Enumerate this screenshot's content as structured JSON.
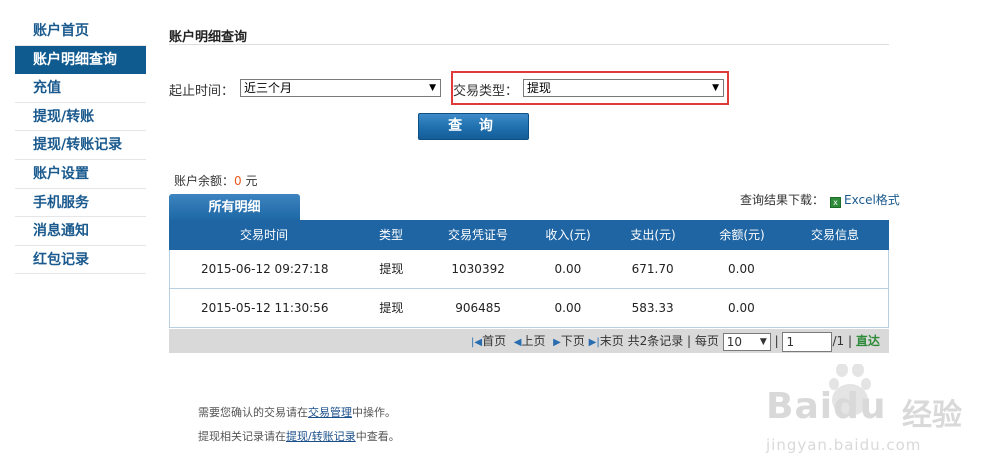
{
  "sidebar": {
    "items": [
      {
        "label": "账户首页"
      },
      {
        "label": "账户明细查询"
      },
      {
        "label": "充值"
      },
      {
        "label": "提现/转账"
      },
      {
        "label": "提现/转账记录"
      },
      {
        "label": "账户设置"
      },
      {
        "label": "手机服务"
      },
      {
        "label": "消息通知"
      },
      {
        "label": "红包记录"
      }
    ],
    "active_index": 1
  },
  "main": {
    "title": "账户明细查询",
    "filters": {
      "date_label": "起止时间：",
      "date_value": "近三个月",
      "type_label": "交易类型：",
      "type_value": "提现"
    },
    "query_button": "查 询",
    "balance_label": "账户余额：",
    "balance_value": "0",
    "balance_unit": "元",
    "download_label": "查询结果下载：",
    "download_link": "Excel格式",
    "tab_label": "所有明细",
    "table": {
      "headers": [
        "交易时间",
        "类型",
        "交易凭证号",
        "收入(元)",
        "支出(元)",
        "余额(元)",
        "交易信息"
      ],
      "rows": [
        [
          "2015-06-12 09:27:18",
          "提现",
          "1030392",
          "0.00",
          "671.70",
          "0.00",
          ""
        ],
        [
          "2015-05-12 11:30:56",
          "提现",
          "906485",
          "0.00",
          "583.33",
          "0.00",
          ""
        ]
      ]
    },
    "pager": {
      "first": "首页",
      "prev": "上页",
      "next": "下页",
      "last": "末页",
      "summary": "共2条记录",
      "per_page_label": "每页",
      "per_page_value": "10",
      "page_input": "1",
      "total_pages": "/1",
      "go": "直达"
    },
    "notes": [
      {
        "before": "需要您确认的交易请在",
        "link": "交易管理",
        "after": "中操作。"
      },
      {
        "before": "提现相关记录请在",
        "link": "提现/转账记录",
        "after": "中查看。"
      }
    ]
  },
  "watermark": {
    "brand": "Baidu",
    "sub": "经验",
    "url": "jingyan.baidu.com"
  },
  "colors": {
    "primary": "#1f65a3",
    "highlight_border": "#e03a3a",
    "balance_number": "#e85a1c"
  }
}
